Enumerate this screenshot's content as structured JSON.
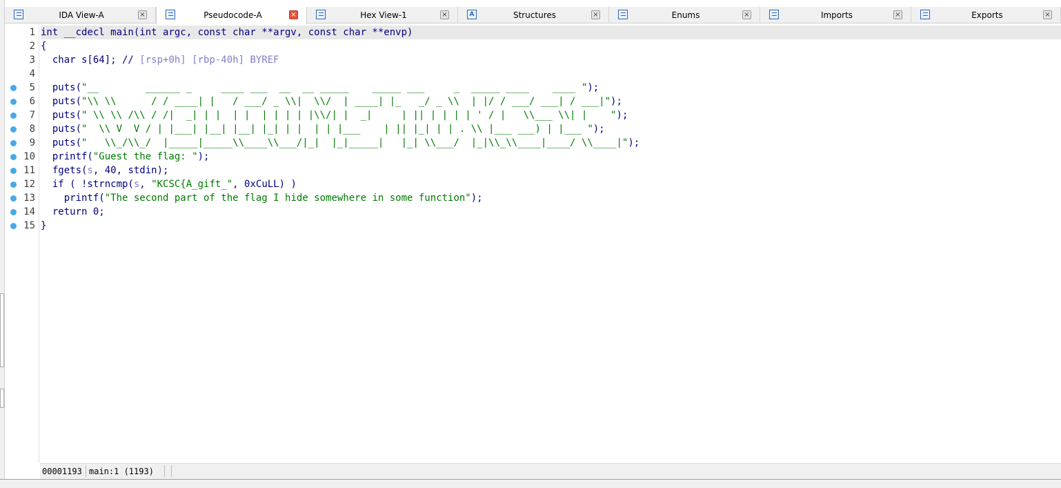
{
  "tabs": [
    {
      "label": "IDA View-A",
      "icon": "ida-view-icon",
      "active": false
    },
    {
      "label": "Pseudocode-A",
      "icon": "pseudocode-icon",
      "active": true
    },
    {
      "label": "Hex View-1",
      "icon": "hex-view-icon",
      "active": false
    },
    {
      "label": "Structures",
      "icon": "structures-icon",
      "glyph": "A",
      "active": false
    },
    {
      "label": "Enums",
      "icon": "enums-icon",
      "active": false
    },
    {
      "label": "Imports",
      "icon": "imports-icon",
      "active": false
    },
    {
      "label": "Exports",
      "icon": "exports-icon",
      "active": false
    }
  ],
  "close_glyph": "×",
  "code": {
    "lines": [
      {
        "num": "1",
        "breakpoint": false,
        "segments": [
          {
            "t": "int __cdecl main(int argc, const char **argv, const char **envp)",
            "c": "kw"
          }
        ]
      },
      {
        "num": "2",
        "breakpoint": false,
        "segments": [
          {
            "t": "{",
            "c": "pun"
          }
        ]
      },
      {
        "num": "3",
        "breakpoint": false,
        "segments": [
          {
            "t": "  char s[64]; // ",
            "c": "kw"
          },
          {
            "t": "[rsp+0h] [rbp-40h] BYREF",
            "c": "cmt"
          }
        ]
      },
      {
        "num": "4",
        "breakpoint": false,
        "segments": [
          {
            "t": "",
            "c": "kw"
          }
        ]
      },
      {
        "num": "5",
        "breakpoint": true,
        "segments": [
          {
            "t": "  puts(",
            "c": "kw"
          },
          {
            "t": "\"__        ______ _     ____ ___  __  __ _____    _____ ___     _  _____ ____    ____ \"",
            "c": "str"
          },
          {
            "t": ");",
            "c": "pun"
          }
        ]
      },
      {
        "num": "6",
        "breakpoint": true,
        "segments": [
          {
            "t": "  puts(",
            "c": "kw"
          },
          {
            "t": "\"\\\\ \\\\      / / ____| |   / ___/ _ \\\\|  \\\\/  | ____| |_   _/ _ \\\\  | |/ / ___/ ___| / ___|\"",
            "c": "str"
          },
          {
            "t": ");",
            "c": "pun"
          }
        ]
      },
      {
        "num": "7",
        "breakpoint": true,
        "segments": [
          {
            "t": "  puts(",
            "c": "kw"
          },
          {
            "t": "\" \\\\ \\\\ /\\\\ / /|  _| | |  | |  | | | | |\\\\/| |  _|     | || | | | | ' / |   \\\\___ \\\\| |    \"",
            "c": "str"
          },
          {
            "t": ");",
            "c": "pun"
          }
        ]
      },
      {
        "num": "8",
        "breakpoint": true,
        "segments": [
          {
            "t": "  puts(",
            "c": "kw"
          },
          {
            "t": "\"  \\\\ V  V / | |___| |__| |__| |_| | |  | | |___    | || |_| | | . \\\\ |___ ___) | |___ \"",
            "c": "str"
          },
          {
            "t": ");",
            "c": "pun"
          }
        ]
      },
      {
        "num": "9",
        "breakpoint": true,
        "segments": [
          {
            "t": "  puts(",
            "c": "kw"
          },
          {
            "t": "\"   \\\\_/\\\\_/  |_____|_____\\\\____\\\\___/|_|  |_|_____|   |_| \\\\___/  |_|\\\\_\\\\____|____/ \\\\____|\"",
            "c": "str"
          },
          {
            "t": ");",
            "c": "pun"
          }
        ]
      },
      {
        "num": "10",
        "breakpoint": true,
        "segments": [
          {
            "t": "  printf(",
            "c": "kw"
          },
          {
            "t": "\"Guest the flag: \"",
            "c": "str"
          },
          {
            "t": ");",
            "c": "pun"
          }
        ]
      },
      {
        "num": "11",
        "breakpoint": true,
        "segments": [
          {
            "t": "  fgets(",
            "c": "kw"
          },
          {
            "t": "s",
            "c": "cmt"
          },
          {
            "t": ", 40, stdin);",
            "c": "kw"
          }
        ]
      },
      {
        "num": "12",
        "breakpoint": true,
        "segments": [
          {
            "t": "  if ( !strncmp(",
            "c": "kw"
          },
          {
            "t": "s",
            "c": "cmt"
          },
          {
            "t": ", ",
            "c": "kw"
          },
          {
            "t": "\"KCSC{A_gift_\"",
            "c": "str"
          },
          {
            "t": ", 0xCuLL) )",
            "c": "kw"
          }
        ]
      },
      {
        "num": "13",
        "breakpoint": true,
        "segments": [
          {
            "t": "    printf(",
            "c": "kw"
          },
          {
            "t": "\"The second part of the flag I hide somewhere in some function\"",
            "c": "str"
          },
          {
            "t": ");",
            "c": "pun"
          }
        ]
      },
      {
        "num": "14",
        "breakpoint": true,
        "segments": [
          {
            "t": "  return 0;",
            "c": "kw"
          }
        ]
      },
      {
        "num": "15",
        "breakpoint": true,
        "segments": [
          {
            "t": "}",
            "c": "pun"
          }
        ]
      }
    ]
  },
  "status": {
    "address": "00001193",
    "location": "main:1 (1193)"
  },
  "colors": {
    "keyword": "#000080",
    "string": "#007a00",
    "comment": "#7f7fc7",
    "breakpoint": "#46a9e8",
    "close_active": "#e2553d"
  }
}
